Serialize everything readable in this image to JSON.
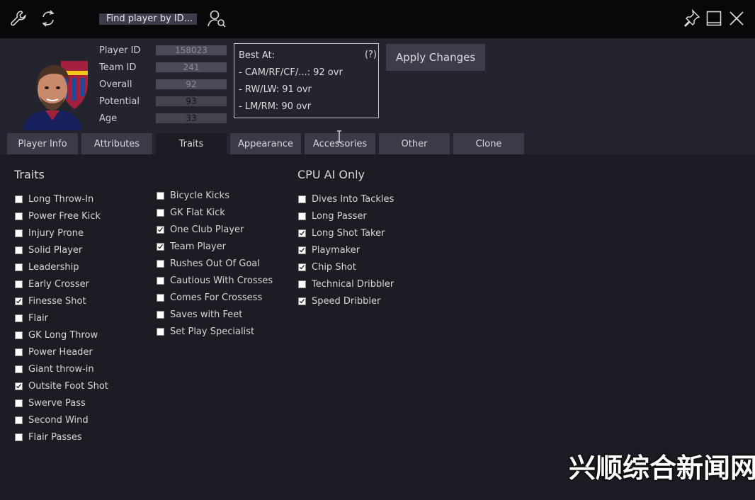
{
  "toolbar": {
    "search_placeholder": "Find player by ID...",
    "search_value": "Find player by ID..."
  },
  "player": {
    "fields": [
      {
        "label": "Player ID",
        "value": "158023"
      },
      {
        "label": "Team ID",
        "value": "241"
      },
      {
        "label": "Overall",
        "value": "92"
      },
      {
        "label": "Potential",
        "value": "93"
      },
      {
        "label": "Age",
        "value": "33"
      }
    ]
  },
  "best_at": {
    "title": "Best At:",
    "help": "(?)",
    "lines": [
      "- CAM/RF/CF/...: 92 ovr",
      "- RW/LW: 91 ovr",
      "- LM/RM: 90 ovr"
    ]
  },
  "apply_label": "Apply Changes",
  "tabs": [
    {
      "label": "Player Info",
      "active": false
    },
    {
      "label": "Attributes",
      "active": false
    },
    {
      "label": "Traits",
      "active": true
    },
    {
      "label": "Appearance",
      "active": false
    },
    {
      "label": "Accessories",
      "active": false
    },
    {
      "label": "Other",
      "active": false
    },
    {
      "label": "Clone",
      "active": false
    }
  ],
  "traits": {
    "title": "Traits",
    "col1": [
      {
        "label": "Long Throw-In",
        "checked": false
      },
      {
        "label": "Power Free Kick",
        "checked": false
      },
      {
        "label": "Injury Prone",
        "checked": false
      },
      {
        "label": "Solid Player",
        "checked": false
      },
      {
        "label": "Leadership",
        "checked": false
      },
      {
        "label": "Early Crosser",
        "checked": false
      },
      {
        "label": "Finesse Shot",
        "checked": true
      },
      {
        "label": "Flair",
        "checked": false
      },
      {
        "label": "GK Long Throw",
        "checked": false
      },
      {
        "label": "Power Header",
        "checked": false
      },
      {
        "label": "Giant throw-in",
        "checked": false
      },
      {
        "label": "Outsite Foot Shot",
        "checked": true
      },
      {
        "label": "Swerve Pass",
        "checked": false
      },
      {
        "label": "Second Wind",
        "checked": false
      },
      {
        "label": "Flair Passes",
        "checked": false
      }
    ],
    "col2": [
      {
        "label": "Bicycle Kicks",
        "checked": false
      },
      {
        "label": "GK Flat Kick",
        "checked": false
      },
      {
        "label": "One Club Player",
        "checked": true
      },
      {
        "label": "Team Player",
        "checked": true
      },
      {
        "label": "Rushes Out Of Goal",
        "checked": false
      },
      {
        "label": "Cautious With Crosses",
        "checked": false
      },
      {
        "label": "Comes For Crossess",
        "checked": false
      },
      {
        "label": "Saves with Feet",
        "checked": false
      },
      {
        "label": "Set Play Specialist",
        "checked": false
      }
    ]
  },
  "cpu_ai": {
    "title": "CPU AI Only",
    "items": [
      {
        "label": "Dives Into Tackles",
        "checked": false
      },
      {
        "label": "Long Passer",
        "checked": false
      },
      {
        "label": "Long Shot Taker",
        "checked": true
      },
      {
        "label": "Playmaker",
        "checked": true
      },
      {
        "label": "Chip Shot",
        "checked": true
      },
      {
        "label": "Technical Dribbler",
        "checked": false
      },
      {
        "label": "Speed Dribbler",
        "checked": true
      }
    ]
  },
  "watermark": "兴顺综合新闻网",
  "colors": {
    "background": "#1c1c24",
    "header": "#24242e",
    "topbar": "#08080b",
    "tab": "#3a3a48",
    "field": "#4a4a5a"
  },
  "icons": [
    "wrench-icon",
    "refresh-icon",
    "user-search-icon",
    "pin-icon",
    "minimize-icon",
    "close-icon",
    "text-cursor-icon"
  ]
}
